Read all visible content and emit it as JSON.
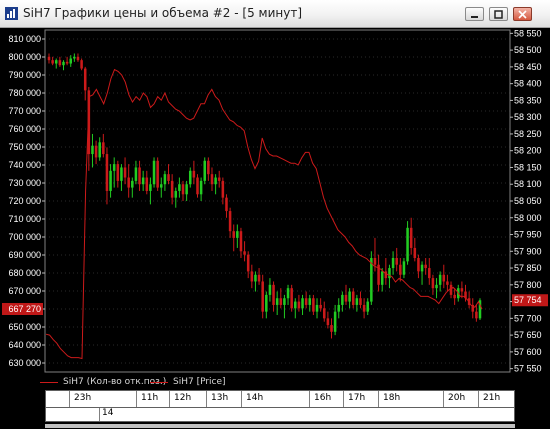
{
  "window": {
    "title": "SiH7 Графики цены и объема #2 - [5 минут]"
  },
  "colors": {
    "bull": "#22cc22",
    "bear": "#cc1a1a",
    "oi_line": "#cc1a1a",
    "grid": "#555555",
    "axis_text": "#ffffff"
  },
  "chart_data": {
    "type": "candlestick+line",
    "left_axis": {
      "label": "Кол-во отк.поз.",
      "ticks": [
        "810 000",
        "800 000",
        "790 000",
        "780 000",
        "770 000",
        "760 000",
        "750 000",
        "740 000",
        "730 000",
        "720 000",
        "710 000",
        "700 000",
        "690 000",
        "680 000",
        "670 000",
        "660 000",
        "650 000",
        "640 000",
        "630 000"
      ],
      "ylim": [
        625000,
        815000
      ],
      "current_label": "667 270"
    },
    "right_axis": {
      "label": "Price",
      "ticks": [
        "58 550",
        "58 500",
        "58 450",
        "58 400",
        "58 350",
        "58 300",
        "58 250",
        "58 200",
        "58 150",
        "58 100",
        "58 050",
        "58 000",
        "57 950",
        "57 900",
        "57 850",
        "57 800",
        "57 750",
        "57 700",
        "57 650",
        "57 600",
        "57 550"
      ],
      "ylim": [
        57540,
        58560
      ],
      "current_label": "57 754"
    },
    "grid": true,
    "series": [
      {
        "name": "SiH7 (Кол-во отк.поз.)",
        "kind": "line",
        "axis": "left",
        "values": [
          646000,
          645500,
          643000,
          641000,
          638000,
          636000,
          634000,
          633000,
          633000,
          633000,
          632500,
          726000,
          778000,
          779000,
          782000,
          778000,
          774000,
          780000,
          788000,
          793000,
          792000,
          790000,
          786000,
          779000,
          775000,
          778000,
          776000,
          780000,
          778000,
          772000,
          774000,
          778000,
          776000,
          780000,
          775000,
          773000,
          771000,
          770000,
          768000,
          766000,
          765000,
          766000,
          770000,
          774000,
          774000,
          779000,
          782000,
          778000,
          776000,
          771000,
          768000,
          765000,
          764000,
          762000,
          761000,
          759000,
          750000,
          743000,
          738000,
          742000,
          755000,
          749000,
          746000,
          745000,
          745000,
          744000,
          743000,
          742000,
          741000,
          741000,
          740000,
          744000,
          747000,
          747000,
          741000,
          738000,
          730000,
          722000,
          716000,
          712000,
          708000,
          704000,
          702000,
          700000,
          697000,
          695000,
          692000,
          690000,
          689000,
          688000,
          686000,
          684000,
          683000,
          682000,
          680000,
          679000,
          678000,
          675000,
          677000,
          676000,
          674000,
          672000,
          671000,
          669000,
          667000,
          667000,
          667000,
          666000,
          665000,
          663000,
          666000,
          669000,
          671000,
          672000,
          670000,
          667000,
          667000,
          665000,
          662000,
          661000,
          664000,
          660000
        ]
      },
      {
        "name": "SiH7 [Price]",
        "kind": "candlestick",
        "axis": "right",
        "ohlc": [
          [
            58480,
            58490,
            58460,
            58470
          ],
          [
            58470,
            58480,
            58455,
            58460
          ],
          [
            58460,
            58475,
            58445,
            58470
          ],
          [
            58470,
            58480,
            58450,
            58455
          ],
          [
            58455,
            58470,
            58440,
            58465
          ],
          [
            58465,
            58480,
            58455,
            58460
          ],
          [
            58460,
            58485,
            58450,
            58475
          ],
          [
            58475,
            58490,
            58465,
            58480
          ],
          [
            58480,
            58490,
            58465,
            58470
          ],
          [
            58470,
            58475,
            58440,
            58445
          ],
          [
            58445,
            58450,
            58350,
            58380
          ],
          [
            58380,
            58390,
            58140,
            58190
          ],
          [
            58190,
            58250,
            58150,
            58215
          ],
          [
            58215,
            58230,
            58160,
            58180
          ],
          [
            58180,
            58240,
            58170,
            58225
          ],
          [
            58225,
            58250,
            58180,
            58190
          ],
          [
            58190,
            58210,
            58040,
            58080
          ],
          [
            58080,
            58160,
            58060,
            58140
          ],
          [
            58140,
            58180,
            58090,
            58160
          ],
          [
            58160,
            58170,
            58090,
            58110
          ],
          [
            58110,
            58160,
            58080,
            58150
          ],
          [
            58150,
            58180,
            58100,
            58120
          ],
          [
            58120,
            58160,
            58060,
            58090
          ],
          [
            58090,
            58120,
            58060,
            58110
          ],
          [
            58110,
            58170,
            58100,
            58150
          ],
          [
            58150,
            58170,
            58080,
            58100
          ],
          [
            58100,
            58140,
            58080,
            58120
          ],
          [
            58120,
            58140,
            58070,
            58080
          ],
          [
            58080,
            58120,
            58040,
            58100
          ],
          [
            58100,
            58180,
            58090,
            58170
          ],
          [
            58170,
            58180,
            58080,
            58090
          ],
          [
            58090,
            58120,
            58060,
            58100
          ],
          [
            58100,
            58140,
            58080,
            58130
          ],
          [
            58130,
            58160,
            58100,
            58110
          ],
          [
            58110,
            58130,
            58040,
            58060
          ],
          [
            58060,
            58090,
            58030,
            58080
          ],
          [
            58080,
            58120,
            58060,
            58100
          ],
          [
            58100,
            58110,
            58050,
            58070
          ],
          [
            58070,
            58110,
            58050,
            58100
          ],
          [
            58100,
            58150,
            58090,
            58140
          ],
          [
            58140,
            58170,
            58100,
            58120
          ],
          [
            58120,
            58130,
            58060,
            58070
          ],
          [
            58070,
            58120,
            58050,
            58110
          ],
          [
            58110,
            58180,
            58100,
            58170
          ],
          [
            58170,
            58180,
            58110,
            58130
          ],
          [
            58130,
            58150,
            58080,
            58100
          ],
          [
            58100,
            58130,
            58070,
            58120
          ],
          [
            58120,
            58140,
            58090,
            58110
          ],
          [
            58110,
            58120,
            58040,
            58060
          ],
          [
            58060,
            58070,
            58000,
            58020
          ],
          [
            58020,
            58030,
            57940,
            57960
          ],
          [
            57960,
            57980,
            57900,
            57940
          ],
          [
            57940,
            57980,
            57910,
            57960
          ],
          [
            57960,
            57970,
            57880,
            57900
          ],
          [
            57900,
            57930,
            57870,
            57890
          ],
          [
            57890,
            57900,
            57820,
            57840
          ],
          [
            57840,
            57860,
            57790,
            57810
          ],
          [
            57810,
            57840,
            57780,
            57830
          ],
          [
            57830,
            57850,
            57800,
            57810
          ],
          [
            57810,
            57830,
            57700,
            57720
          ],
          [
            57720,
            57780,
            57700,
            57770
          ],
          [
            57770,
            57820,
            57750,
            57800
          ],
          [
            57800,
            57810,
            57720,
            57740
          ],
          [
            57740,
            57780,
            57710,
            57760
          ],
          [
            57760,
            57790,
            57730,
            57740
          ],
          [
            57740,
            57770,
            57700,
            57760
          ],
          [
            57760,
            57800,
            57740,
            57790
          ],
          [
            57790,
            57800,
            57720,
            57730
          ],
          [
            57730,
            57760,
            57700,
            57750
          ],
          [
            57750,
            57770,
            57720,
            57730
          ],
          [
            57730,
            57770,
            57710,
            57760
          ],
          [
            57760,
            57780,
            57730,
            57740
          ],
          [
            57740,
            57770,
            57720,
            57760
          ],
          [
            57760,
            57770,
            57710,
            57720
          ],
          [
            57720,
            57760,
            57700,
            57740
          ],
          [
            57740,
            57760,
            57720,
            57730
          ],
          [
            57730,
            57750,
            57690,
            57700
          ],
          [
            57700,
            57720,
            57670,
            57680
          ],
          [
            57680,
            57700,
            57640,
            57660
          ],
          [
            57660,
            57740,
            57650,
            57720
          ],
          [
            57720,
            57760,
            57700,
            57740
          ],
          [
            57740,
            57780,
            57720,
            57770
          ],
          [
            57770,
            57800,
            57740,
            57750
          ],
          [
            57750,
            57790,
            57730,
            57780
          ],
          [
            57780,
            57790,
            57730,
            57740
          ],
          [
            57740,
            57770,
            57720,
            57760
          ],
          [
            57760,
            57780,
            57730,
            57740
          ],
          [
            57740,
            57760,
            57700,
            57720
          ],
          [
            57720,
            57760,
            57710,
            57750
          ],
          [
            57750,
            57900,
            57740,
            57880
          ],
          [
            57880,
            57940,
            57840,
            57860
          ],
          [
            57860,
            57890,
            57780,
            57800
          ],
          [
            57800,
            57850,
            57780,
            57840
          ],
          [
            57840,
            57880,
            57800,
            57820
          ],
          [
            57820,
            57860,
            57790,
            57850
          ],
          [
            57850,
            57900,
            57830,
            57880
          ],
          [
            57880,
            57910,
            57840,
            57860
          ],
          [
            57860,
            57880,
            57810,
            57830
          ],
          [
            57830,
            57880,
            57820,
            57870
          ],
          [
            57870,
            57990,
            57860,
            57970
          ],
          [
            57970,
            58000,
            57890,
            57910
          ],
          [
            57910,
            57940,
            57870,
            57880
          ],
          [
            57880,
            57890,
            57820,
            57840
          ],
          [
            57840,
            57870,
            57800,
            57860
          ],
          [
            57860,
            57880,
            57830,
            57850
          ],
          [
            57850,
            57880,
            57800,
            57820
          ],
          [
            57820,
            57830,
            57770,
            57790
          ],
          [
            57790,
            57820,
            57760,
            57800
          ],
          [
            57800,
            57840,
            57780,
            57830
          ],
          [
            57830,
            57860,
            57790,
            57810
          ],
          [
            57810,
            57830,
            57780,
            57800
          ],
          [
            57800,
            57810,
            57760,
            57770
          ],
          [
            57770,
            57790,
            57740,
            57760
          ],
          [
            57760,
            57800,
            57750,
            57790
          ],
          [
            57790,
            57810,
            57760,
            57780
          ],
          [
            57780,
            57800,
            57750,
            57760
          ],
          [
            57760,
            57780,
            57730,
            57740
          ],
          [
            57740,
            57760,
            57700,
            57720
          ],
          [
            57720,
            57740,
            57690,
            57700
          ],
          [
            57700,
            57760,
            57695,
            57754
          ]
        ]
      }
    ],
    "time_labels": [
      "23h",
      "11h",
      "12h",
      "13h",
      "14h",
      "16h",
      "17h",
      "18h",
      "20h",
      "21h"
    ],
    "date_labels": [
      "14"
    ]
  },
  "legend": {
    "series1": "SiH7 (Кол-во отк.поз.)",
    "series2": "SiH7 [Price]"
  }
}
